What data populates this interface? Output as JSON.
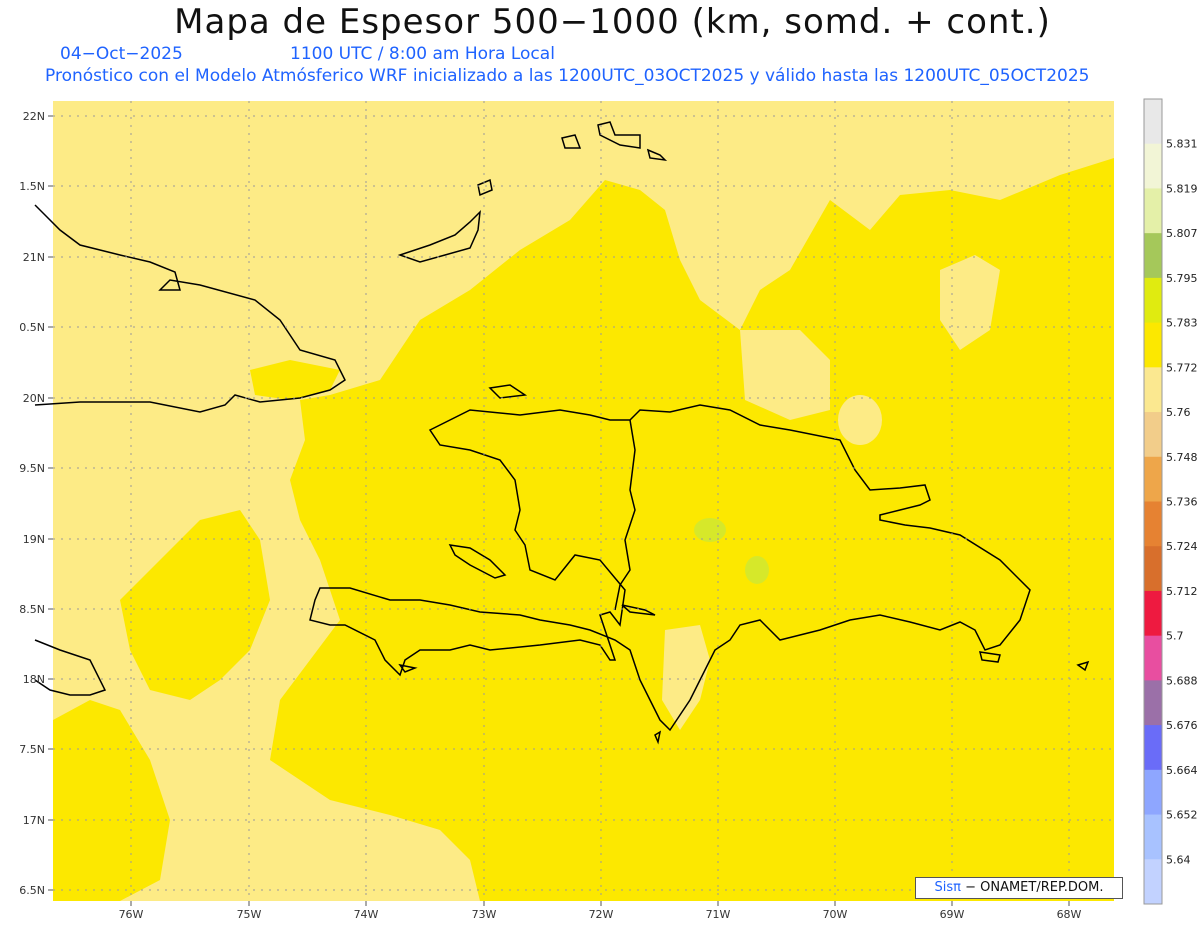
{
  "header": {
    "title": "Mapa de Espesor 500−1000 (km, somd. + cont.)",
    "date": "04−Oct−2025",
    "time": "1100 UTC / 8:00 am Hora Local",
    "forecast_line": "Pronóstico con el Modelo Atmósferico WRF inicializado a las 1200UTC_03OCT2025 y válido hasta las  1200UTC_05OCT2025"
  },
  "map": {
    "lon_labels": [
      "76W",
      "75W",
      "74W",
      "73W",
      "72W",
      "71W",
      "70W",
      "69W",
      "68W"
    ],
    "lat_labels": [
      "22N",
      "1.5N",
      "21N",
      "0.5N",
      "20N",
      "9.5N",
      "19N",
      "8.5N",
      "18N",
      "7.5N",
      "17N",
      "6.5N"
    ],
    "colors": {
      "ocean_field": "#fce800",
      "low_field": "#fdeb86",
      "high_field": "#d6e82a",
      "coast": "#000000",
      "grid": "#9a9a9a"
    }
  },
  "colorbar": {
    "levels": [
      "5.831",
      "5.819",
      "5.807",
      "5.795",
      "5.783",
      "5.772",
      "5.76",
      "5.748",
      "5.736",
      "5.724",
      "5.712",
      "5.7",
      "5.688",
      "5.676",
      "5.664",
      "5.652",
      "5.64"
    ],
    "colors": [
      "#e8e8e8",
      "#f2f5d6",
      "#e4f0a8",
      "#a5c85a",
      "#e0eb10",
      "#fce800",
      "#fbe890",
      "#f2cd8a",
      "#eea64a",
      "#e68232",
      "#d86f2c",
      "#ee1a40",
      "#e84ea0",
      "#9b70a8",
      "#6a6cf8",
      "#8ea6ff",
      "#a8c2ff",
      "#c2d2ff"
    ]
  },
  "credit": {
    "sis": "Sis",
    "pi": "π",
    "rest": "− ONAMET/REP.DOM."
  }
}
